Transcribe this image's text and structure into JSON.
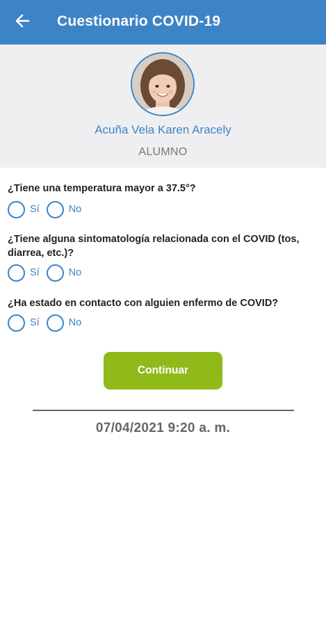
{
  "header": {
    "title": "Cuestionario COVID-19",
    "back_icon": "arrow-left-icon",
    "color": "#3d84c6"
  },
  "profile": {
    "name": "Acuña Vela Karen Aracely",
    "role": "ALUMNO",
    "avatar": "student-photo"
  },
  "questions": [
    {
      "text": "¿Tiene una temperatura mayor a 37.5°?",
      "options": [
        "Sí",
        "No"
      ],
      "selected": null
    },
    {
      "text": "¿Tiene alguna sintomatología relacionada con el COVID (tos, diarrea, etc.)?",
      "options": [
        "Sí",
        "No"
      ],
      "selected": null
    },
    {
      "text": "¿Ha estado en contacto con alguien enfermo de COVID?",
      "options": [
        "Sí",
        "No"
      ],
      "selected": null
    }
  ],
  "actions": {
    "continue_label": "Continuar",
    "button_color": "#8fba1a"
  },
  "footer": {
    "timestamp": "07/04/2021 9:20 a. m."
  }
}
